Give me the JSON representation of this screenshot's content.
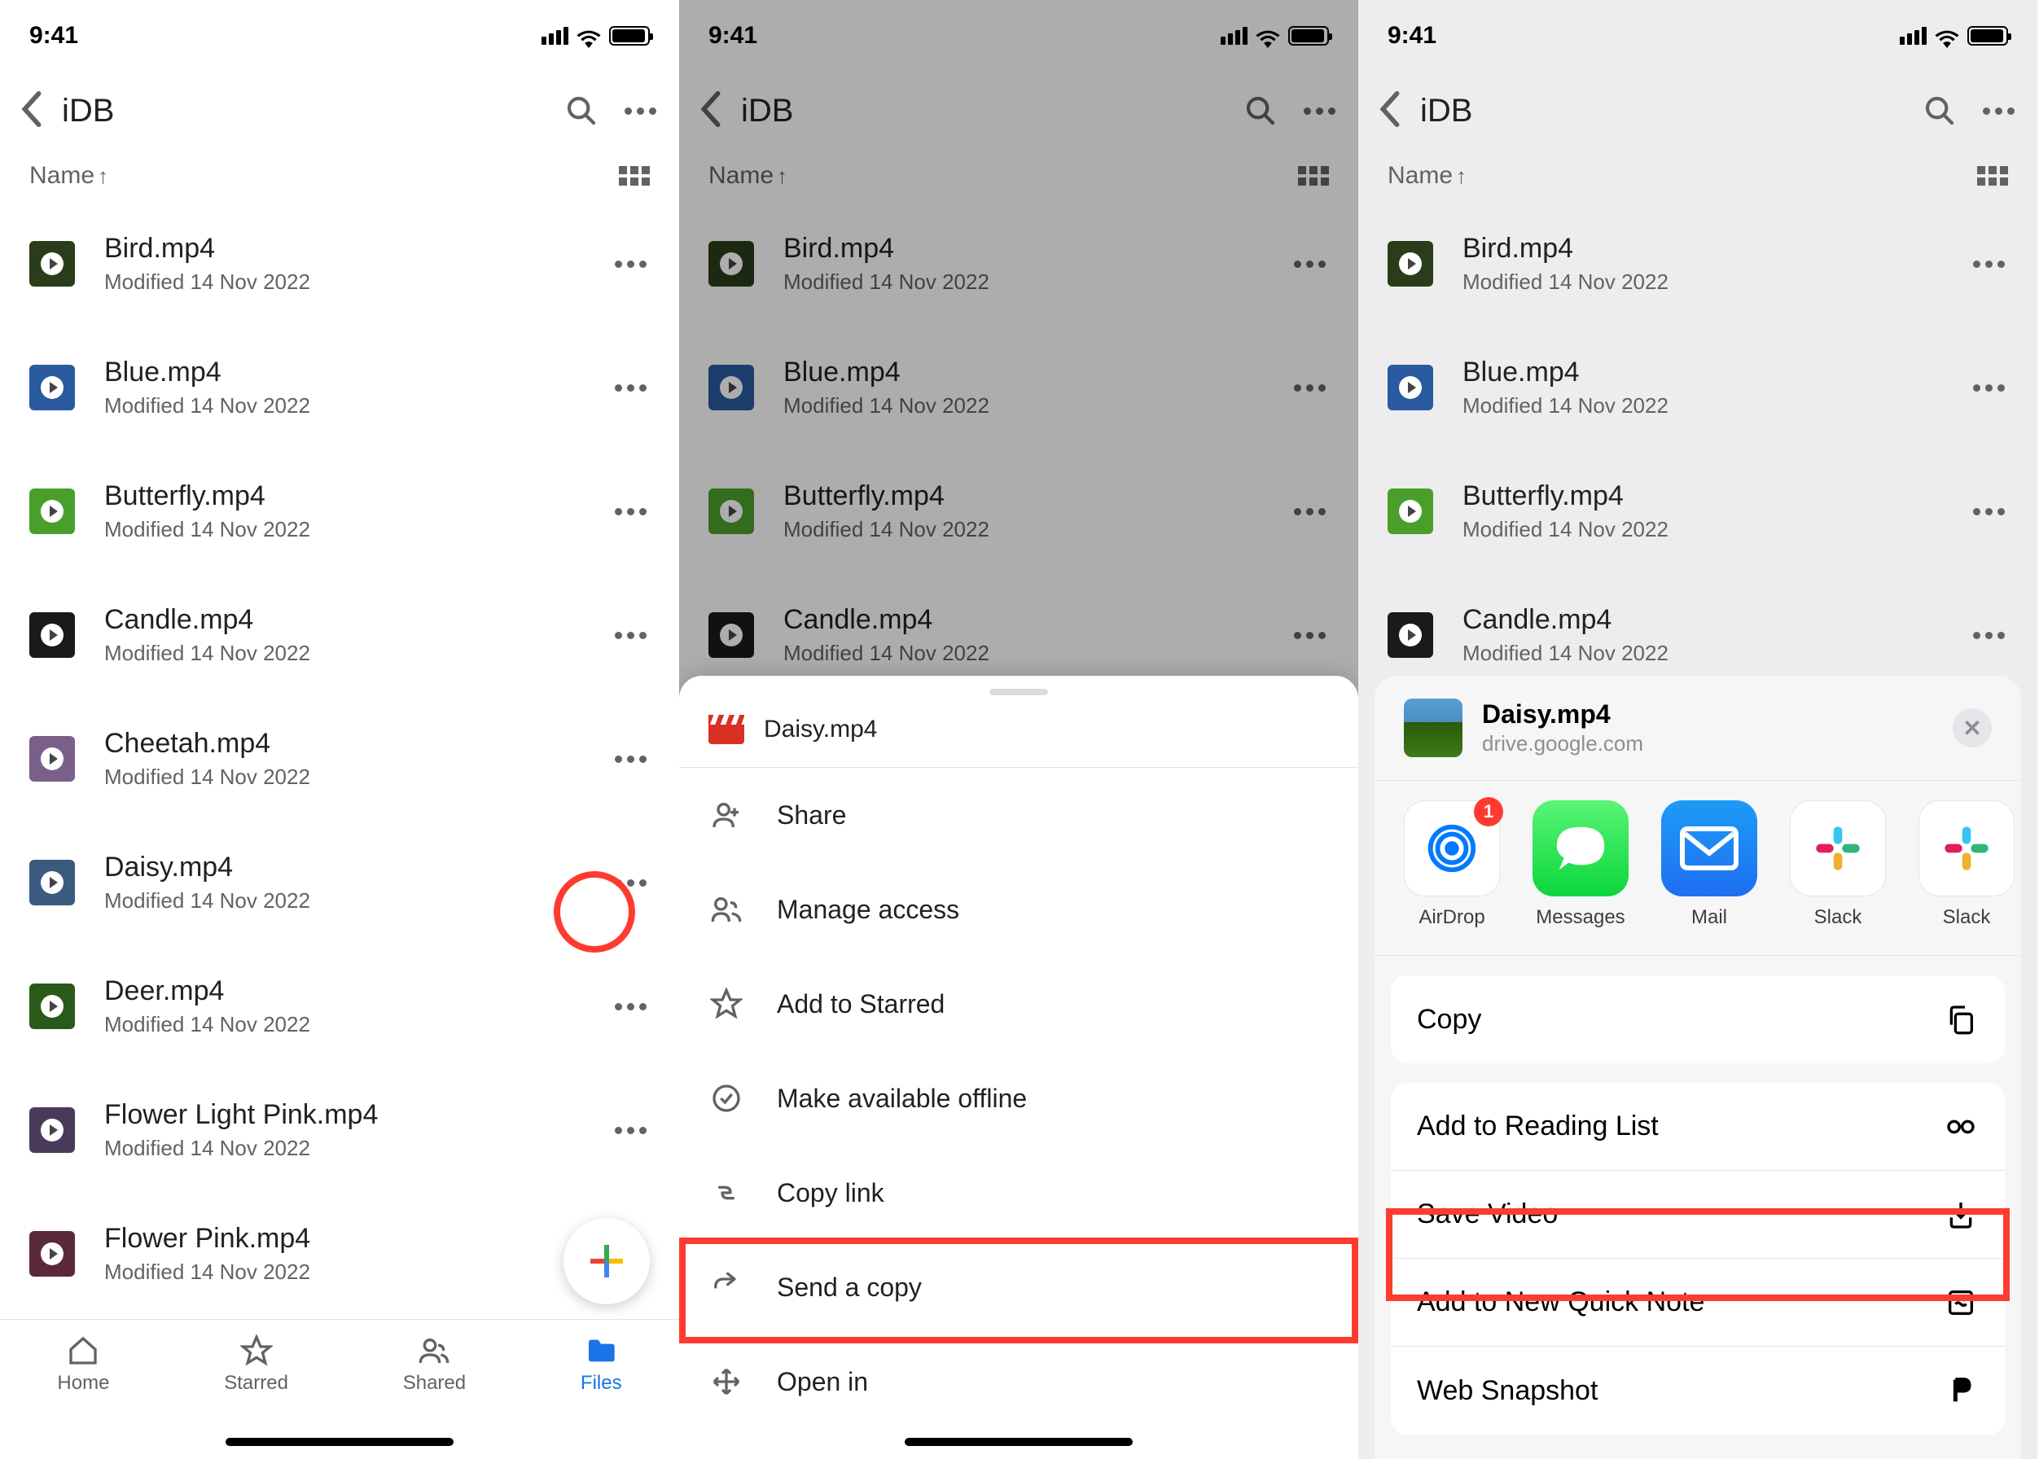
{
  "status": {
    "time": "9:41"
  },
  "header": {
    "title": "iDB"
  },
  "sort": {
    "label": "Name",
    "direction": "↑"
  },
  "files": [
    {
      "name": "Bird.mp4",
      "meta": "Modified 14 Nov 2022",
      "thumb": "#2a3d1a"
    },
    {
      "name": "Blue.mp4",
      "meta": "Modified 14 Nov 2022",
      "thumb": "#2a5a9f"
    },
    {
      "name": "Butterfly.mp4",
      "meta": "Modified 14 Nov 2022",
      "thumb": "#4a9f2a"
    },
    {
      "name": "Candle.mp4",
      "meta": "Modified 14 Nov 2022",
      "thumb": "#1a1a1a"
    },
    {
      "name": "Cheetah.mp4",
      "meta": "Modified 14 Nov 2022",
      "thumb": "#7a5f8a"
    },
    {
      "name": "Daisy.mp4",
      "meta": "Modified 14 Nov 2022",
      "thumb": "#3a5a7f"
    },
    {
      "name": "Deer.mp4",
      "meta": "Modified 14 Nov 2022",
      "thumb": "#2a5a1a"
    },
    {
      "name": "Flower Light Pink.mp4",
      "meta": "Modified 14 Nov 2022",
      "thumb": "#4a3a5a"
    },
    {
      "name": "Flower Pink.mp4",
      "meta": "Modified 14 Nov 2022",
      "thumb": "#5a2a3a"
    }
  ],
  "tabs": [
    {
      "label": "Home"
    },
    {
      "label": "Starred"
    },
    {
      "label": "Shared"
    },
    {
      "label": "Files"
    }
  ],
  "sheet2": {
    "filename": "Daisy.mp4",
    "items": [
      {
        "label": "Share",
        "icon": "person-plus"
      },
      {
        "label": "Manage access",
        "icon": "people"
      },
      {
        "label": "Add to Starred",
        "icon": "star"
      },
      {
        "label": "Make available offline",
        "icon": "check-circle"
      },
      {
        "label": "Copy link",
        "icon": "link"
      },
      {
        "label": "Send a copy",
        "icon": "arrow-share"
      },
      {
        "label": "Open in",
        "icon": "move"
      }
    ]
  },
  "sheet3": {
    "filename": "Daisy.mp4",
    "source": "drive.google.com",
    "apps": [
      {
        "label": "AirDrop",
        "badge": "1"
      },
      {
        "label": "Messages",
        "badge": null
      },
      {
        "label": "Mail",
        "badge": null
      },
      {
        "label": "Slack",
        "badge": null
      },
      {
        "label": "Slack",
        "badge": null
      }
    ],
    "group1": [
      {
        "label": "Copy",
        "icon": "copy"
      }
    ],
    "group2": [
      {
        "label": "Add to Reading List",
        "icon": "glasses"
      },
      {
        "label": "Save Video",
        "icon": "download"
      },
      {
        "label": "Add to New Quick Note",
        "icon": "note"
      },
      {
        "label": "Web Snapshot",
        "icon": "p"
      }
    ]
  },
  "panel2_visible_files": 4
}
